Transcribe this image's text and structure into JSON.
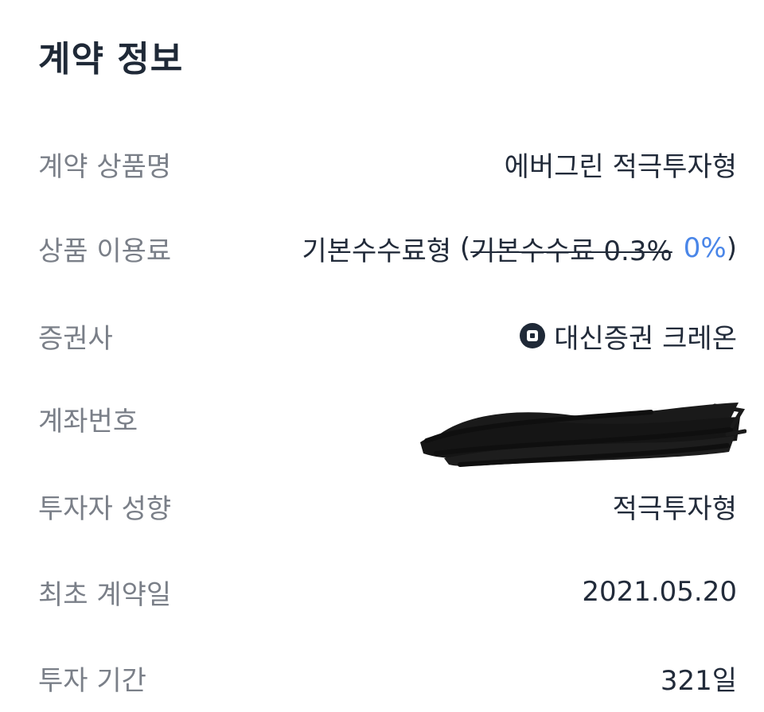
{
  "section_title": "계약 정보",
  "rows": [
    {
      "label": "계약 상품명",
      "value": "에버그린 적극투자형"
    },
    {
      "label": "상품 이용료",
      "value_main": "기본수수료형 ",
      "paren_open": "(",
      "value_strike": "기본수수료 0.3%",
      "value_accent": "0%",
      "paren_close": ")"
    },
    {
      "label": "증권사",
      "value": "대신증권 크레온",
      "icon": "broker-logo-icon"
    },
    {
      "label": "계좌번호",
      "value_redacted": true
    },
    {
      "label": "투자자 성향",
      "value": "적극투자형"
    },
    {
      "label": "최초 계약일",
      "value": "2021.05.20"
    },
    {
      "label": "투자 기간",
      "value": "321일"
    }
  ],
  "colors": {
    "label": "#7a7f88",
    "value": "#222b3a",
    "accent": "#4a86e8"
  }
}
